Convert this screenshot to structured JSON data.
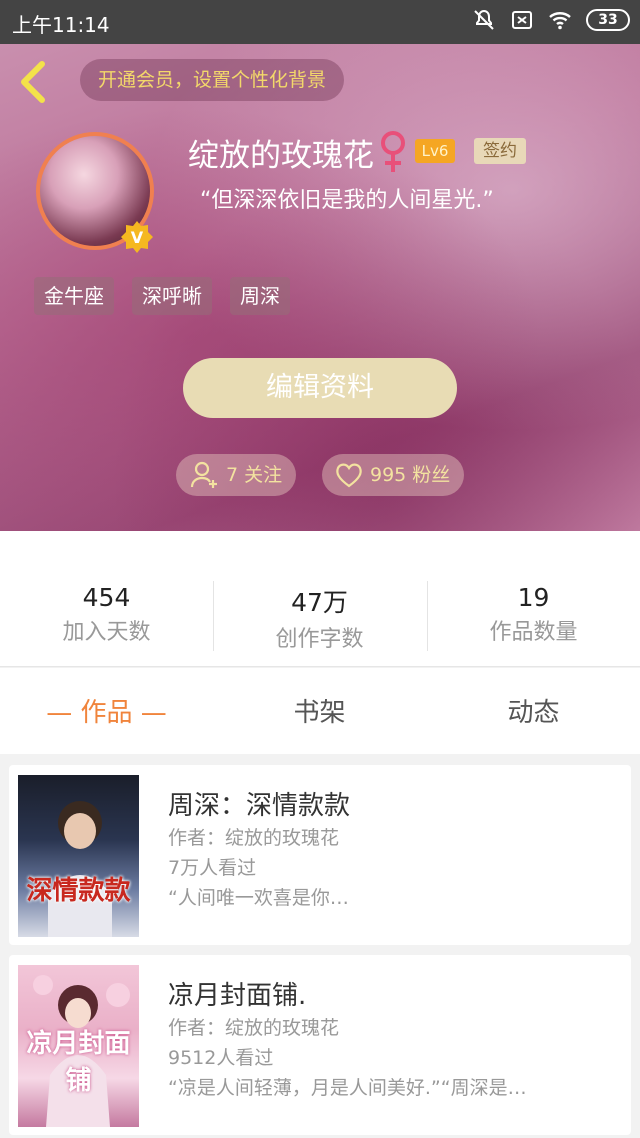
{
  "status_bar": {
    "time": "上午11:14",
    "battery": "33"
  },
  "header": {
    "vip_prompt": "开通会员，设置个性化背景",
    "username": "绽放的玫瑰花",
    "level": "Lv6",
    "signed": "签约",
    "motto": "“但深深依旧是我的人间星光.”",
    "tags": [
      "金牛座",
      "深呼晰",
      "周深"
    ],
    "edit_label": "编辑资料",
    "follow_label": "7 关注",
    "fans_label": "995 粉丝"
  },
  "stats": [
    {
      "value": "454",
      "label": "加入天数"
    },
    {
      "value": "47万",
      "label": "创作字数"
    },
    {
      "value": "19",
      "label": "作品数量"
    }
  ],
  "tabs": [
    {
      "label": "— 作品 —"
    },
    {
      "label": "书架"
    },
    {
      "label": "动态"
    }
  ],
  "works": [
    {
      "title": "周深：深情款款",
      "author": "作者：绽放的玫瑰花",
      "views": "7万人看过",
      "desc": "“人间唯一欢喜是你…",
      "cover_text": "深情款款"
    },
    {
      "title": "凉月封面铺.",
      "author": "作者：绽放的玫瑰花",
      "views": "9512人看过",
      "desc": "“凉是人间轻薄，月是人间美好.”“周深是…",
      "cover_text": "凉月封面铺"
    }
  ],
  "colors": {
    "accent": "#f0843c",
    "vip_gold": "#f3d86a",
    "edit_button": "#e8dcb4"
  }
}
